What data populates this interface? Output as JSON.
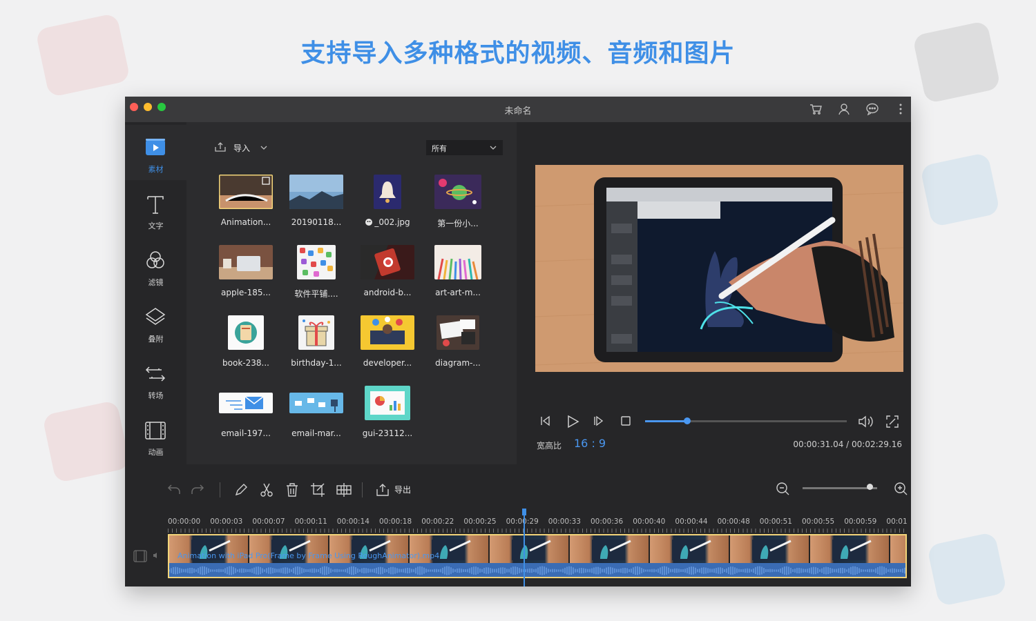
{
  "headline": "支持导入多种格式的视频、音频和图片",
  "colors": {
    "accent": "#3f8fe6",
    "close": "#fe5f57",
    "minimize": "#febc2e",
    "zoom": "#28c840"
  },
  "window": {
    "title": "未命名",
    "toolbar_icons": [
      "cart-icon",
      "user-icon",
      "chat-icon",
      "more-icon"
    ]
  },
  "sidebar": {
    "items": [
      {
        "label": "素材",
        "icon": "media-icon",
        "active": true
      },
      {
        "label": "文字",
        "icon": "text-icon",
        "active": false
      },
      {
        "label": "滤镜",
        "icon": "filter-icon",
        "active": false
      },
      {
        "label": "叠附",
        "icon": "overlay-icon",
        "active": false
      },
      {
        "label": "转场",
        "icon": "transition-icon",
        "active": false
      },
      {
        "label": "动画",
        "icon": "animation-icon",
        "active": false
      }
    ]
  },
  "media": {
    "import_label": "导入",
    "filter_value": "所有",
    "items": [
      {
        "label": "Animation..."
      },
      {
        "label": "20190118..."
      },
      {
        "label": "_002.jpg"
      },
      {
        "label": "第一份小..."
      },
      {
        "label": "apple-185..."
      },
      {
        "label": "软件平铺...."
      },
      {
        "label": "android-b..."
      },
      {
        "label": "art-art-m..."
      },
      {
        "label": "book-238..."
      },
      {
        "label": "birthday-1..."
      },
      {
        "label": "developer..."
      },
      {
        "label": "diagram-..."
      },
      {
        "label": "email-197..."
      },
      {
        "label": "email-mar..."
      },
      {
        "label": "gui-23112..."
      }
    ]
  },
  "preview": {
    "progress": 0.21,
    "aspect_label": "宽高比",
    "aspect_value": "16 : 9",
    "timecode": "00:00:31.04 / 00:02:29.16"
  },
  "timeline": {
    "export_label": "导出",
    "zoom_level": 0.9,
    "ruler_labels": [
      "00:00:00",
      "00:00:03",
      "00:00:07",
      "00:00:11",
      "00:00:14",
      "00:00:18",
      "00:00:22",
      "00:00:25",
      "00:00:29",
      "00:00:33",
      "00:00:36",
      "00:00:40",
      "00:00:44",
      "00:00:48",
      "00:00:51",
      "00:00:55",
      "00:00:59",
      "00:01:"
    ],
    "clip_name": "Animation with iPad Pro(Frame by Frame Using RoughAnimator).mp4",
    "playhead_time": "00:00:29"
  }
}
